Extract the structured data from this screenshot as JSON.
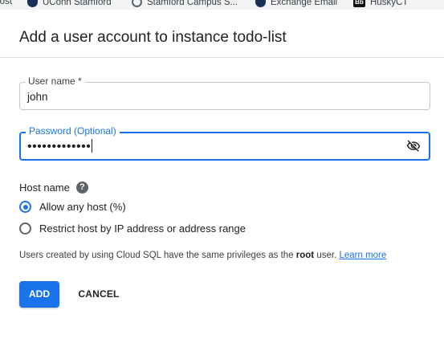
{
  "bookmarks": [
    {
      "label": "Post",
      "icon": "none"
    },
    {
      "label": "UConn Stamford",
      "icon": "uconn-icon"
    },
    {
      "label": "Stamford Campus S...",
      "icon": "globe-icon"
    },
    {
      "label": "Exchange Email",
      "icon": "uconn-icon"
    },
    {
      "label": "HuskyCT",
      "icon": "blackboard-icon",
      "icon_text": "Bb"
    }
  ],
  "dialog": {
    "title": "Add a user account to instance todo-list"
  },
  "username": {
    "label": "User name *",
    "value": "john"
  },
  "password": {
    "label": "Password (Optional)",
    "value": "•••••••••••••"
  },
  "host": {
    "label": "Host name",
    "help": "?",
    "options": [
      {
        "label": "Allow any host (%)",
        "checked": true
      },
      {
        "label": "Restrict host by IP address or address range",
        "checked": false
      }
    ]
  },
  "info": {
    "prefix": "Users created by using Cloud SQL have the same privileges as the",
    "bold": "root",
    "suffix": "user.",
    "link": "Learn more"
  },
  "buttons": {
    "add": "ADD",
    "cancel": "CANCEL"
  },
  "colors": {
    "accent": "#1a73e8",
    "text": "#202124",
    "border": "#c4c7c5"
  }
}
